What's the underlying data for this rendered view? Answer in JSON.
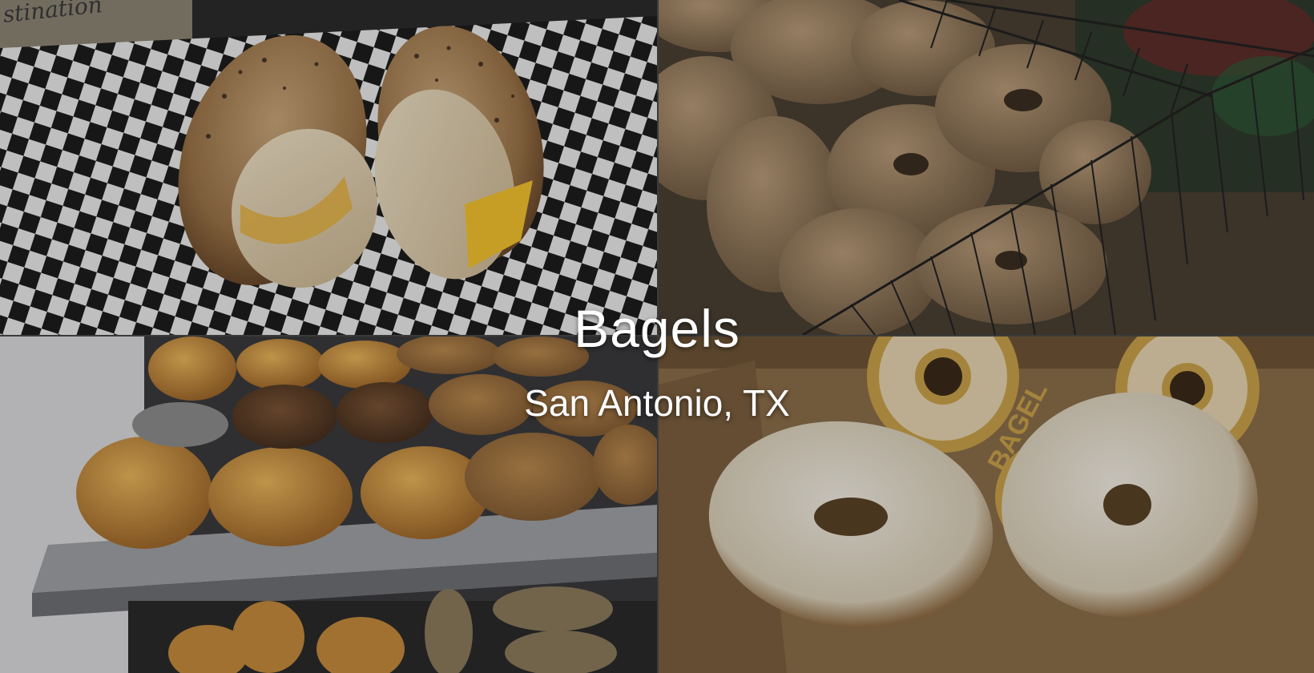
{
  "title": "Bagels",
  "subtitle": "San Antonio, TX",
  "photo_text": {
    "corner_sign": "stination",
    "bag_print": "BAGEL"
  },
  "colors": {
    "title_text": "#ffffff",
    "checker_dark": "#1d1d1d",
    "checker_light": "#e9e9e9",
    "bag_brown": "#8a6d4a",
    "bag_gold": "#c9a24a"
  }
}
